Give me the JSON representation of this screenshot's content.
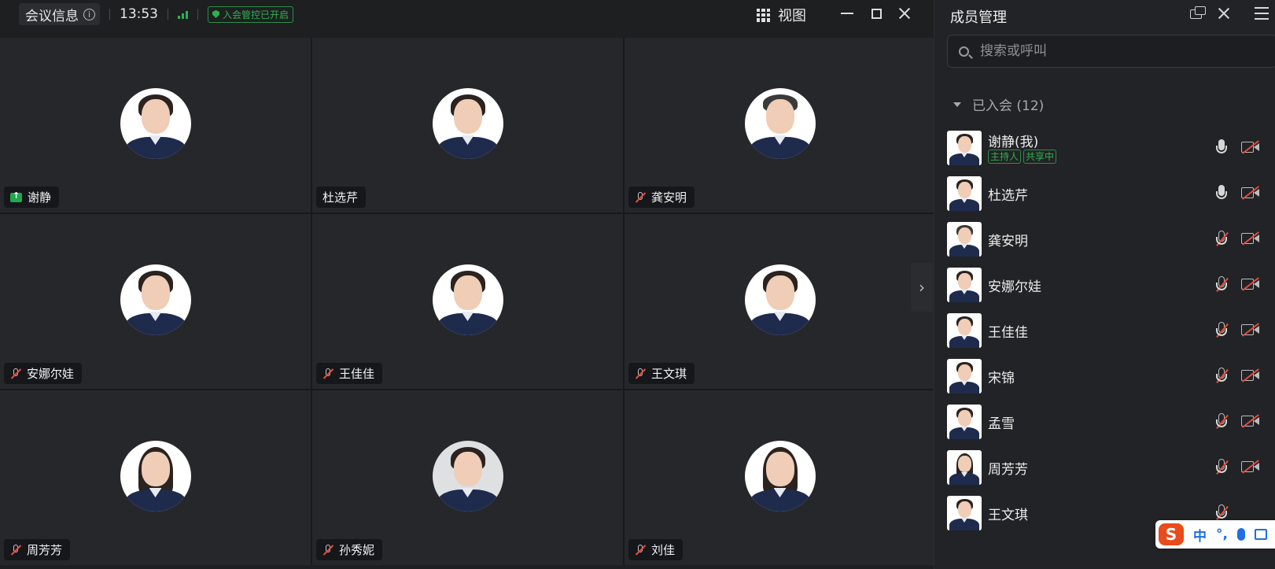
{
  "topbar": {
    "meeting_info_label": "会议信息",
    "time": "13:53",
    "lock_badge": "入会管控已开启",
    "view_label": "视图"
  },
  "tiles": [
    {
      "name": "谢静",
      "status": "sharing",
      "hair": "mid"
    },
    {
      "name": "杜选芹",
      "status": "none",
      "hair": "mid"
    },
    {
      "name": "龚安明",
      "status": "muted",
      "hair": "short"
    },
    {
      "name": "安娜尔娃",
      "status": "muted",
      "hair": "mid"
    },
    {
      "name": "王佳佳",
      "status": "muted",
      "hair": "mid"
    },
    {
      "name": "王文琪",
      "status": "muted",
      "hair": "mid"
    },
    {
      "name": "周芳芳",
      "status": "muted",
      "hair": "long"
    },
    {
      "name": "孙秀妮",
      "status": "muted",
      "hair": "mid"
    },
    {
      "name": "刘佳",
      "status": "muted",
      "hair": "long"
    }
  ],
  "panel": {
    "title": "成员管理",
    "search_placeholder": "搜索或呼叫",
    "section_label": "已入会 (12)",
    "members": [
      {
        "name": "谢静(我)",
        "tags": [
          "主持人",
          "共享中"
        ],
        "mic": "on"
      },
      {
        "name": "杜选芹",
        "tags": [],
        "mic": "on"
      },
      {
        "name": "龚安明",
        "tags": [],
        "mic": "off"
      },
      {
        "name": "安娜尔娃",
        "tags": [],
        "mic": "off"
      },
      {
        "name": "王佳佳",
        "tags": [],
        "mic": "off"
      },
      {
        "name": "宋锦",
        "tags": [],
        "mic": "off"
      },
      {
        "name": "孟雪",
        "tags": [],
        "mic": "off"
      },
      {
        "name": "周芳芳",
        "tags": [],
        "mic": "off"
      },
      {
        "name": "王文琪",
        "tags": [],
        "mic": "off"
      }
    ]
  },
  "ime": {
    "logo": "S",
    "mode": "中",
    "punct": "°,"
  },
  "colors": {
    "accent_green": "#2fb04f",
    "mute_red": "#e64b3c",
    "panel_bg": "#222326",
    "tile_bg": "#25272a"
  }
}
